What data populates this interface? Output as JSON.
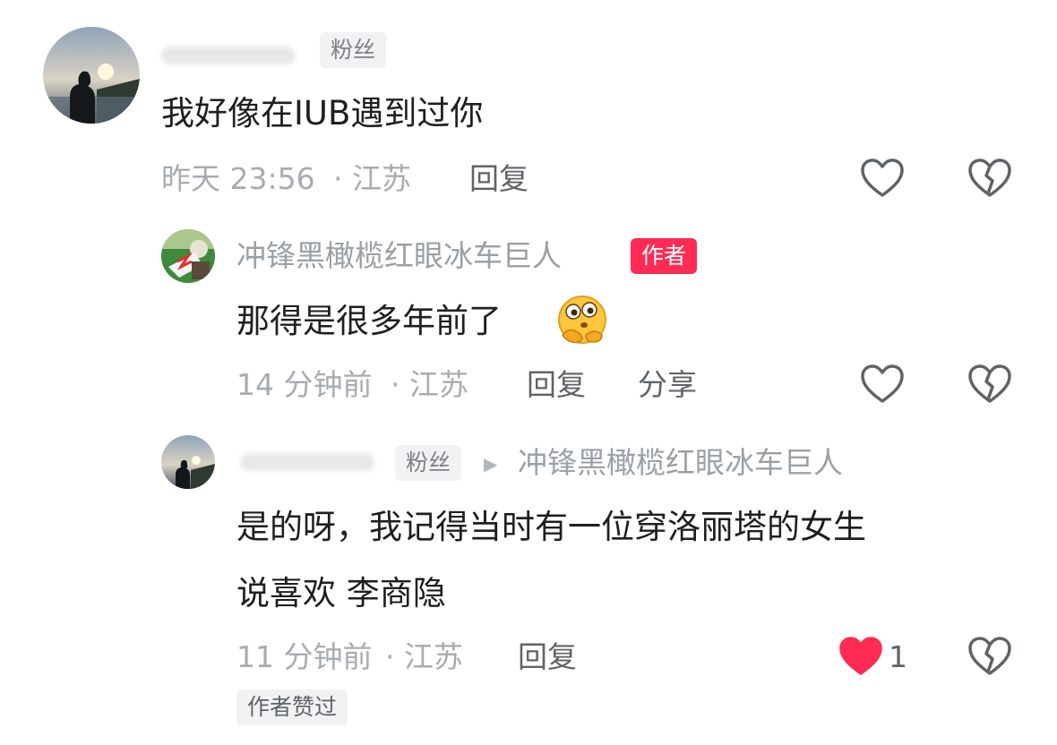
{
  "comment1": {
    "badge": "粉丝",
    "text": "我好像在IUB遇到过你",
    "time": "昨天 23:56",
    "location": "· 江苏",
    "reply_label": "回复"
  },
  "reply1": {
    "username": "冲锋黑橄榄红眼冰车巨人",
    "author_badge": "作者",
    "text": "那得是很多年前了",
    "time": "14 分钟前",
    "location": "· 江苏",
    "reply_label": "回复",
    "share_label": "分享"
  },
  "reply2": {
    "badge": "粉丝",
    "reply_to_arrow": "▶",
    "reply_to": "冲锋黑橄榄红眼冰车巨人",
    "text_line1": "是的呀，我记得当时有一位穿洛丽塔的女生",
    "text_line2": "说喜欢 李商隐",
    "time": "11 分钟前",
    "location": "· 江苏",
    "reply_label": "回复",
    "like_count": "1",
    "author_liked": "作者赞过"
  },
  "colors": {
    "like_active": "#fe2c55",
    "author_badge_bg": "#fe2c55",
    "meta_gray": "#a8acb1"
  },
  "icons": [
    "heart-outline-icon",
    "broken-heart-icon",
    "heart-filled-icon",
    "thinking-emoji-icon"
  ]
}
